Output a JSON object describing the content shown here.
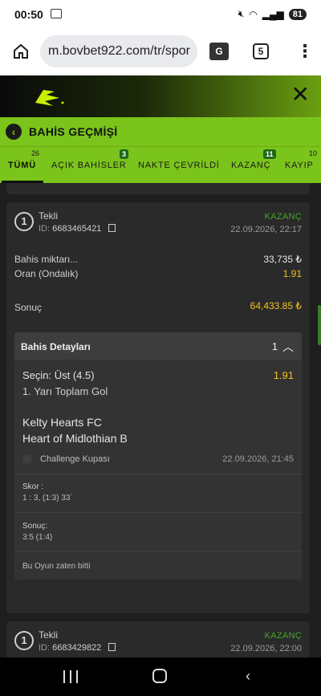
{
  "status_bar": {
    "time": "00:50",
    "battery": "81"
  },
  "browser": {
    "url": "m.bovbet922.com/tr/spor",
    "tab_count": "5"
  },
  "header": {
    "title": "BAHİS GEÇMİŞİ"
  },
  "tabs": [
    {
      "label": "TÜMÜ",
      "count": "26"
    },
    {
      "label": "AÇIK BAHİSLER",
      "count": "3"
    },
    {
      "label": "NAKTE ÇEVRİLDİ",
      "count": ""
    },
    {
      "label": "KAZANÇ",
      "count": "11"
    },
    {
      "label": "KAYIP",
      "count": "10"
    }
  ],
  "bets": [
    {
      "index": "1",
      "type": "Tekli",
      "id_label": "ID:",
      "id": "6683465421",
      "status": "KAZANÇ",
      "datetime": "22.09.2026, 22:17",
      "stake_label": "Bahis miktarı...",
      "stake": "33,735 ₺",
      "odds_label": "Oran (Ondalık)",
      "odds": "1.91",
      "result_label": "Sonuç",
      "result": "64,433.85 ₺",
      "details": {
        "title": "Bahis Detayları",
        "count": "1",
        "selection": "Seçin: Üst (4.5)",
        "selection_odds": "1.91",
        "market": "1. Yarı Toplam Gol",
        "home_team": "Kelty Hearts FC",
        "away_team": "Heart of Midlothian B",
        "league": "Challenge Kupası",
        "event_datetime": "22.09.2026, 21:45",
        "score_label": "Skor :",
        "score": "1 : 3, (1:3) 33`",
        "final_label": "Sonuç:",
        "final": "3:5 (1:4)",
        "note": "Bu Oyun zaten bitti"
      }
    },
    {
      "index": "1",
      "type": "Tekli",
      "id_label": "ID:",
      "id": "6683429822",
      "status": "KAZANÇ",
      "datetime": "22.09.2026, 22:00"
    }
  ],
  "colors": {
    "accent": "#7bc41c",
    "win": "#45a32b",
    "money": "#f2c21b"
  }
}
